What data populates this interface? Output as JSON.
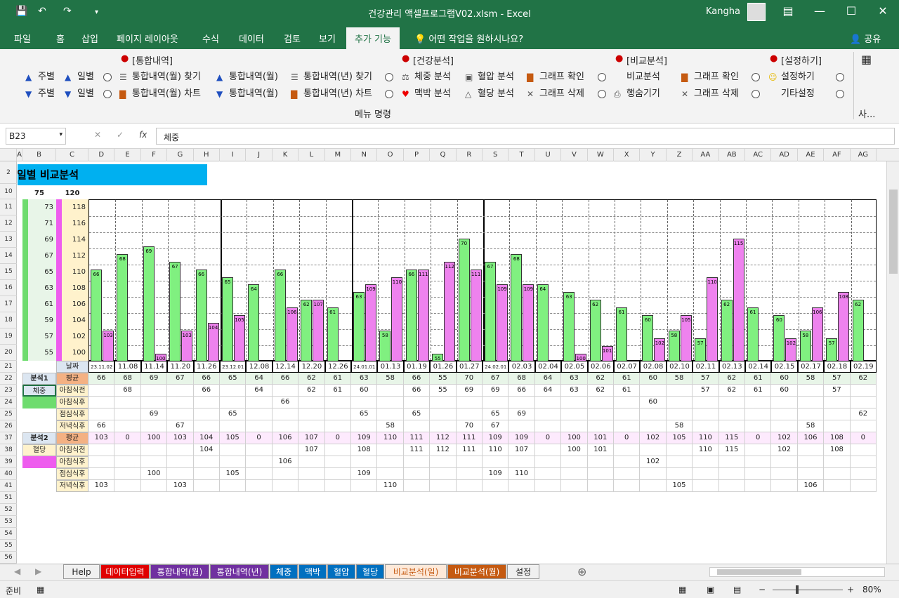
{
  "window": {
    "title": "건강관리 액셀프로그램V02.xlsm  -  Excel",
    "user": "Kangha"
  },
  "tabs": [
    "파일",
    "홈",
    "삽입",
    "페이지 레이아웃",
    "수식",
    "데이터",
    "검토",
    "보기",
    "추가 기능"
  ],
  "tell_me": "어떤 작업을 원하시나요?",
  "share": "공유",
  "ribbon": {
    "groups": [
      "[통합내역]",
      "[건강분석]",
      "[비교분석]",
      "[설정하기]"
    ],
    "group_label": "메뉴 명령",
    "row1": [
      "주별",
      "일별",
      "통합내역(월) 찾기",
      "통합내역(월)",
      "통합내역(년) 찾기",
      "체중 분석",
      "혈압 분석",
      "그래프 확인",
      "비교분석",
      "그래프 확인",
      "설정하기"
    ],
    "row2": [
      "주별",
      "일별",
      "통합내역(월) 차트",
      "통합내역(월)",
      "통합내역(년) 차트",
      "맥박 분석",
      "혈당 분석",
      "그래프 삭제",
      "행숨기기",
      "그래프 삭제",
      "기타설정"
    ],
    "more": "사..."
  },
  "formula_bar": {
    "name_box": "B23",
    "formula": "체중"
  },
  "columns": [
    "A",
    "B",
    "C",
    "D",
    "E",
    "F",
    "G",
    "H",
    "I",
    "J",
    "K",
    "L",
    "M",
    "N",
    "O",
    "P",
    "Q",
    "R",
    "S",
    "T",
    "U",
    "V",
    "W",
    "X",
    "Y",
    "Z",
    "AA",
    "AB",
    "AC",
    "AD",
    "AE",
    "AF",
    "AG"
  ],
  "rows": [
    "2",
    "10",
    "11",
    "12",
    "13",
    "14",
    "15",
    "16",
    "17",
    "18",
    "19",
    "20",
    "21",
    "22",
    "23",
    "24",
    "25",
    "26",
    "37",
    "38",
    "39",
    "40",
    "41",
    "51",
    "52",
    "53",
    "54",
    "55",
    "56"
  ],
  "sheet_title": "일별 비교분석",
  "axis_header": {
    "b": "75",
    "c": "120"
  },
  "axis_b": [
    "73",
    "71",
    "69",
    "67",
    "65",
    "63",
    "61",
    "59",
    "57",
    "55"
  ],
  "axis_c": [
    "118",
    "116",
    "114",
    "112",
    "110",
    "108",
    "106",
    "104",
    "102",
    "100"
  ],
  "labels": {
    "date": "날짜",
    "analysis1": "분석1",
    "analysis2": "분석2",
    "avg": "평균",
    "weight": "체중",
    "glucose": "혈당",
    "before_breakfast": "아침식전",
    "after_breakfast": "아침식후",
    "after_lunch": "점심식후",
    "after_dinner": "저녁식후"
  },
  "chart_data": {
    "type": "bar",
    "categories": [
      "23.11.02",
      "11.08",
      "11.14",
      "11.20",
      "11.26",
      "23.12.01",
      "12.08",
      "12.14",
      "12.20",
      "12.26",
      "24.01.01",
      "01.13",
      "01.19",
      "01.26",
      "01.27",
      "24.02.01",
      "02.03",
      "02.04",
      "02.05",
      "02.06",
      "02.07",
      "02.08",
      "02.10",
      "02.11",
      "02.13",
      "02.14",
      "02.15",
      "02.17",
      "02.18",
      "02.19"
    ],
    "series": [
      {
        "name": "체중",
        "color": "#80f080",
        "ylim": [
          54,
          75
        ],
        "values": [
          66,
          68,
          69,
          67,
          66,
          65,
          64,
          66,
          62,
          61,
          63,
          58,
          66,
          55,
          70,
          67,
          68,
          64,
          63,
          62,
          61,
          60,
          58,
          57,
          62,
          61,
          60,
          58,
          57,
          62
        ]
      },
      {
        "name": "혈당",
        "color": "#ee82ee",
        "ylim": [
          99,
          120
        ],
        "values": [
          103,
          0,
          100,
          103,
          104,
          105,
          0,
          106,
          107,
          0,
          109,
          110,
          111,
          112,
          111,
          109,
          109,
          0,
          100,
          101,
          0,
          102,
          105,
          110,
          115,
          0,
          102,
          106,
          108,
          0
        ]
      }
    ]
  },
  "table": {
    "weight_breakfast": [
      "",
      68,
      "",
      "",
      66,
      "",
      64,
      "",
      62,
      61,
      60,
      "",
      66,
      55,
      69,
      69,
      66,
      64,
      63,
      62,
      61,
      "",
      "",
      57,
      62,
      61,
      60,
      "",
      57,
      ""
    ],
    "weight_after_breakfast": [
      "",
      "",
      "",
      "",
      "",
      "",
      "",
      66,
      "",
      "",
      "",
      "",
      "",
      "",
      "",
      "",
      "",
      "",
      "",
      "",
      "",
      60,
      "",
      "",
      "",
      "",
      "",
      "",
      "",
      ""
    ],
    "weight_after_lunch": [
      "",
      "",
      69,
      "",
      "",
      65,
      "",
      "",
      "",
      "",
      65,
      "",
      65,
      "",
      "",
      65,
      69,
      "",
      "",
      "",
      "",
      "",
      "",
      "",
      "",
      "",
      "",
      "",
      "",
      62
    ],
    "weight_after_dinner": [
      66,
      "",
      "",
      67,
      "",
      "",
      "",
      "",
      "",
      "",
      "",
      58,
      "",
      "",
      70,
      67,
      "",
      "",
      "",
      "",
      "",
      "",
      58,
      "",
      "",
      "",
      "",
      58,
      "",
      ""
    ],
    "glucose_breakfast": [
      "",
      "",
      "",
      "",
      104,
      "",
      "",
      "",
      107,
      "",
      108,
      "",
      111,
      112,
      111,
      110,
      107,
      "",
      100,
      101,
      "",
      "",
      "",
      110,
      115,
      "",
      102,
      "",
      108,
      ""
    ],
    "glucose_after_breakfast": [
      "",
      "",
      "",
      "",
      "",
      "",
      "",
      106,
      "",
      "",
      "",
      "",
      "",
      "",
      "",
      "",
      "",
      "",
      "",
      "",
      "",
      102,
      "",
      "",
      "",
      "",
      "",
      "",
      "",
      ""
    ],
    "glucose_after_lunch": [
      "",
      "",
      100,
      "",
      "",
      105,
      "",
      "",
      "",
      "",
      109,
      "",
      "",
      "",
      "",
      109,
      110,
      "",
      "",
      "",
      "",
      "",
      "",
      "",
      "",
      "",
      "",
      "",
      "",
      ""
    ],
    "glucose_after_dinner": [
      103,
      "",
      "",
      103,
      "",
      "",
      "",
      "",
      "",
      "",
      "",
      110,
      "",
      "",
      "",
      "",
      "",
      "",
      "",
      "",
      "",
      "",
      105,
      "",
      "",
      "",
      "",
      106,
      "",
      ""
    ]
  },
  "sheet_tabs": [
    {
      "label": "Help",
      "color": "#f0f0f0",
      "text": "#222"
    },
    {
      "label": "데이터입력",
      "color": "#e00000",
      "text": "#fff"
    },
    {
      "label": "통합내역(월)",
      "color": "#7030a0",
      "text": "#fff"
    },
    {
      "label": "통합내역(년)",
      "color": "#7030a0",
      "text": "#fff"
    },
    {
      "label": "체중",
      "color": "#0070c0",
      "text": "#fff"
    },
    {
      "label": "맥박",
      "color": "#0070c0",
      "text": "#fff"
    },
    {
      "label": "혈압",
      "color": "#0070c0",
      "text": "#fff"
    },
    {
      "label": "혈당",
      "color": "#0070c0",
      "text": "#fff"
    },
    {
      "label": "비교분석(일)",
      "color": "#fde9d9",
      "text": "#c55a11"
    },
    {
      "label": "비교분석(월)",
      "color": "#c55a11",
      "text": "#fff"
    },
    {
      "label": "설정",
      "color": "#f0f0f0",
      "text": "#222"
    }
  ],
  "status": {
    "ready": "준비",
    "zoom": "80%"
  }
}
